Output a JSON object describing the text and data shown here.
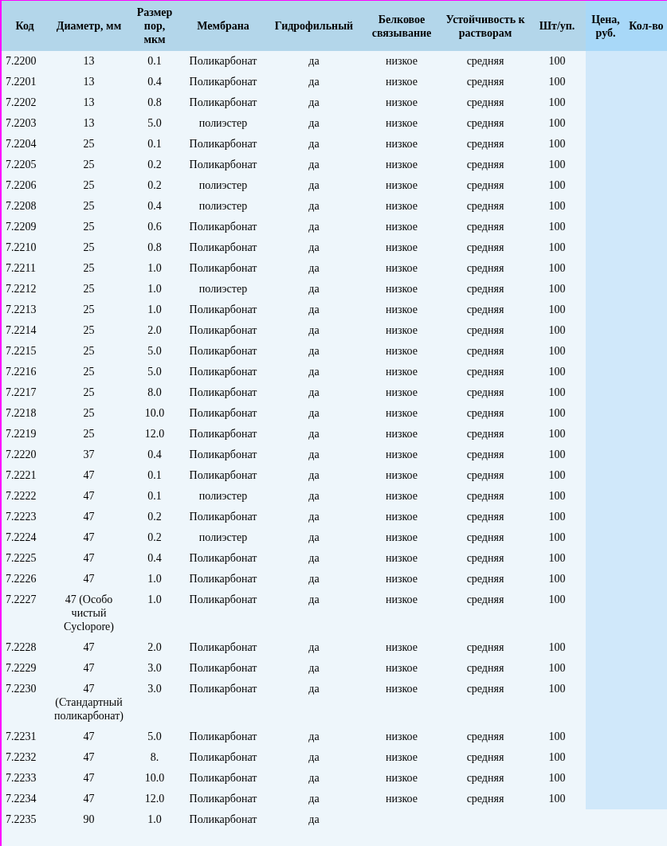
{
  "table": {
    "columns": [
      "Код",
      "Диаметр, мм",
      "Размер пор, мкм",
      "Мембрана",
      "Гидрофильный",
      "Белковое связывание",
      "Устойчивость к растворам",
      "Шт/уп.",
      "Цена, руб.",
      "Кол-во"
    ],
    "rows": [
      [
        "7.2200",
        "13",
        "0.1",
        "Поликарбонат",
        "да",
        "низкое",
        "средняя",
        "100"
      ],
      [
        "7.2201",
        "13",
        "0.4",
        "Поликарбонат",
        "да",
        "низкое",
        "средняя",
        "100"
      ],
      [
        "7.2202",
        "13",
        "0.8",
        "Поликарбонат",
        "да",
        "низкое",
        "средняя",
        "100"
      ],
      [
        "7.2203",
        "13",
        "5.0",
        "полиэстер",
        "да",
        "низкое",
        "средняя",
        "100"
      ],
      [
        "7.2204",
        "25",
        "0.1",
        "Поликарбонат",
        "да",
        "низкое",
        "средняя",
        "100"
      ],
      [
        "7.2205",
        "25",
        "0.2",
        "Поликарбонат",
        "да",
        "низкое",
        "средняя",
        "100"
      ],
      [
        "7.2206",
        "25",
        "0.2",
        "полиэстер",
        "да",
        "низкое",
        "средняя",
        "100"
      ],
      [
        "7.2208",
        "25",
        "0.4",
        "полиэстер",
        "да",
        "низкое",
        "средняя",
        "100"
      ],
      [
        "7.2209",
        "25",
        "0.6",
        "Поликарбонат",
        "да",
        "низкое",
        "средняя",
        "100"
      ],
      [
        "7.2210",
        "25",
        "0.8",
        "Поликарбонат",
        "да",
        "низкое",
        "средняя",
        "100"
      ],
      [
        "7.2211",
        "25",
        "1.0",
        "Поликарбонат",
        "да",
        "низкое",
        "средняя",
        "100"
      ],
      [
        "7.2212",
        "25",
        "1.0",
        "полиэстер",
        "да",
        "низкое",
        "средняя",
        "100"
      ],
      [
        "7.2213",
        "25",
        "1.0",
        "Поликарбонат",
        "да",
        "низкое",
        "средняя",
        "100"
      ],
      [
        "7.2214",
        "25",
        "2.0",
        "Поликарбонат",
        "да",
        "низкое",
        "средняя",
        "100"
      ],
      [
        "7.2215",
        "25",
        "5.0",
        "Поликарбонат",
        "да",
        "низкое",
        "средняя",
        "100"
      ],
      [
        "7.2216",
        "25",
        "5.0",
        "Поликарбонат",
        "да",
        "низкое",
        "средняя",
        "100"
      ],
      [
        "7.2217",
        "25",
        "8.0",
        "Поликарбонат",
        "да",
        "низкое",
        "средняя",
        "100"
      ],
      [
        "7.2218",
        "25",
        "10.0",
        "Поликарбонат",
        "да",
        "низкое",
        "средняя",
        "100"
      ],
      [
        "7.2219",
        "25",
        "12.0",
        "Поликарбонат",
        "да",
        "низкое",
        "средняя",
        "100"
      ],
      [
        "7.2220",
        "37",
        "0.4",
        "Поликарбонат",
        "да",
        "низкое",
        "средняя",
        "100"
      ],
      [
        "7.2221",
        "47",
        "0.1",
        "Поликарбонат",
        "да",
        "низкое",
        "средняя",
        "100"
      ],
      [
        "7.2222",
        "47",
        "0.1",
        "полиэстер",
        "да",
        "низкое",
        "средняя",
        "100"
      ],
      [
        "7.2223",
        "47",
        "0.2",
        "Поликарбонат",
        "да",
        "низкое",
        "средняя",
        "100"
      ],
      [
        "7.2224",
        "47",
        "0.2",
        "полиэстер",
        "да",
        "низкое",
        "средняя",
        "100"
      ],
      [
        "7.2225",
        "47",
        "0.4",
        "Поликарбонат",
        "да",
        "низкое",
        "средняя",
        "100"
      ],
      [
        "7.2226",
        "47",
        "1.0",
        "Поликарбонат",
        "да",
        "низкое",
        "средняя",
        "100"
      ],
      [
        "7.2227",
        "47 (Особо чистый Cyclopore)",
        "1.0",
        "Поликарбонат",
        "да",
        "низкое",
        "средняя",
        "100"
      ],
      [
        "7.2228",
        "47",
        "2.0",
        "Поликарбонат",
        "да",
        "низкое",
        "средняя",
        "100"
      ],
      [
        "7.2229",
        "47",
        "3.0",
        "Поликарбонат",
        "да",
        "низкое",
        "средняя",
        "100"
      ],
      [
        "7.2230",
        "47 (Стандартный поликарбонат)",
        "3.0",
        "Поликарбонат",
        "да",
        "низкое",
        "средняя",
        "100"
      ],
      [
        "7.2231",
        "47",
        "5.0",
        "Поликарбонат",
        "да",
        "низкое",
        "средняя",
        "100"
      ],
      [
        "7.2232",
        "47",
        "8.",
        "Поликарбонат",
        "да",
        "низкое",
        "средняя",
        "100"
      ],
      [
        "7.2233",
        "47",
        "10.0",
        "Поликарбонат",
        "да",
        "низкое",
        "средняя",
        "100"
      ],
      [
        "7.2234",
        "47",
        "12.0",
        "Поликарбонат",
        "да",
        "низкое",
        "средняя",
        "100"
      ],
      [
        "7.2235",
        "90",
        "1.0",
        "Поликарбонат",
        "да"
      ]
    ]
  }
}
